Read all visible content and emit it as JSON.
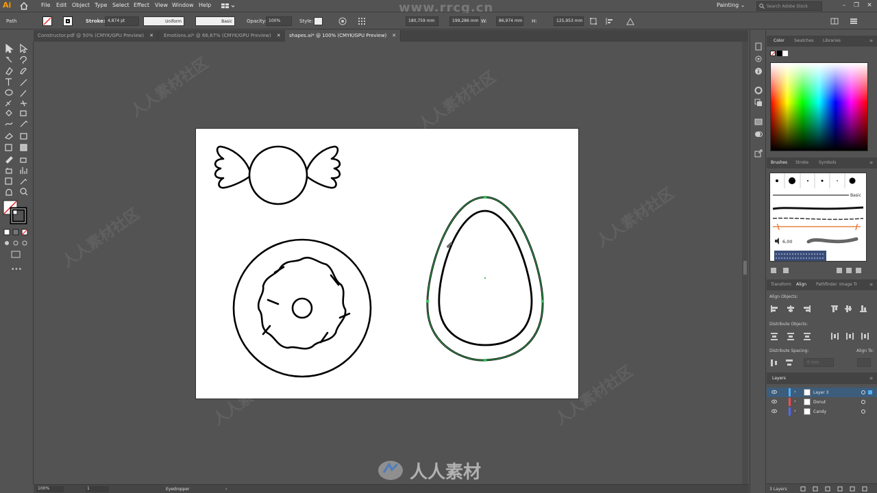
{
  "app": {
    "logo": "Ai",
    "icons": {
      "home": "home-icon",
      "workspace_switcher": "workspace-switcher-icon",
      "search": "search-icon"
    }
  },
  "menu": [
    "File",
    "Edit",
    "Object",
    "Type",
    "Select",
    "Effect",
    "View",
    "Window",
    "Help"
  ],
  "workspace": "Painting",
  "search_placeholder": "Search Adobe Stock",
  "window_controls": [
    "–",
    "❐",
    "✕"
  ],
  "control": {
    "selection": "Path",
    "stroke_label": "Stroke:",
    "stroke_value": "4,874 pt",
    "profile": "Uniform",
    "brush": "Basic",
    "opacity_label": "Opacity:",
    "opacity_value": "100%",
    "style_label": "Style:",
    "x_value": "180,759 mm",
    "y_value": "199,286 mm",
    "w_label": "W:",
    "w_value": "86,974 mm",
    "h_label": "H:",
    "h_value": "125,953 mm"
  },
  "watermark": {
    "top": "www.rrcg.cn",
    "bottom": "人人素材",
    "diag": "人人素材社区"
  },
  "tabs": [
    {
      "label": "Constructor.pdf @ 50% (CMYK/GPU Preview)",
      "active": false
    },
    {
      "label": "Emotions.ai* @ 66,67% (CMYK/GPU Preview)",
      "active": false
    },
    {
      "label": "shapes.ai* @ 100% (CMYK/GPU Preview)",
      "active": true
    }
  ],
  "tab_close": "✕",
  "colors": {
    "ui_bg": "#535353",
    "artboard": "#ffffff",
    "selection": "#3fbf5f",
    "accent": "#ff9a00"
  },
  "panels": {
    "color_tabs": [
      "Color",
      "Swatches",
      "Libraries"
    ],
    "brush_tabs": [
      "Brushes",
      "Stroke",
      "Symbols"
    ],
    "brush_basic": "Basic",
    "brush_size": "6,00",
    "align_tabs": [
      "Transform",
      "Align",
      "Pathfinder",
      "Image Tr"
    ],
    "align_objects": "Align Objects:",
    "distribute_objects": "Distribute Objects:",
    "distribute_spacing": "Distribute Spacing:",
    "align_to": "Align To:",
    "spacing_value": "0 mm",
    "layers_title": "Layers",
    "layers": [
      {
        "name": "Layer 3",
        "color": "#4fb1ff",
        "selected": true
      },
      {
        "name": "Donut",
        "color": "#ff4c4c",
        "selected": false
      },
      {
        "name": "Candy",
        "color": "#4f6bff",
        "selected": false
      }
    ],
    "layers_count": "3 Layers"
  },
  "status": {
    "zoom": "100%",
    "artboard": "1",
    "tool": "Eyedropper"
  }
}
